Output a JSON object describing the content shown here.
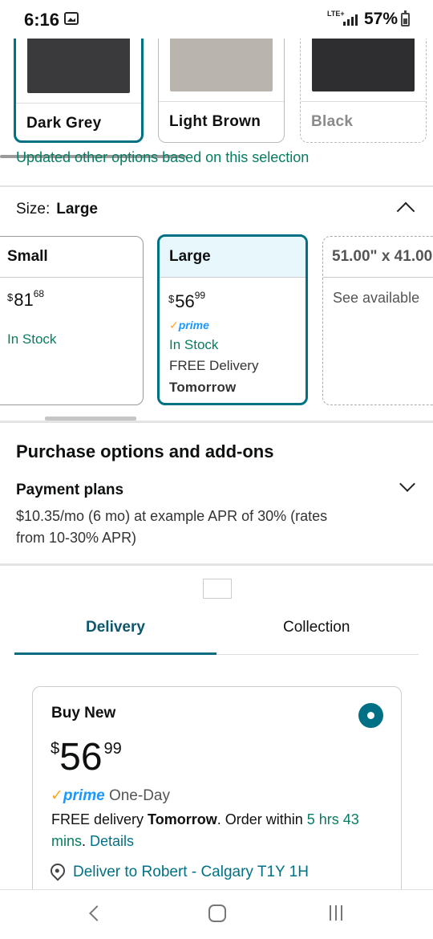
{
  "status_bar": {
    "time": "6:16",
    "network": "LTE+",
    "battery": "57%"
  },
  "colors": {
    "accent": "#007185",
    "success_green": "#067d62",
    "prime_blue": "#1a98ff",
    "prime_check": "#ffa41c",
    "swatches": [
      {
        "label": "Dark Grey",
        "state": "selected",
        "image_color": "#3a3a3c"
      },
      {
        "label": "Light Brown",
        "state": "available",
        "image_color": "#b9b5ae"
      },
      {
        "label": "Black",
        "state": "unavailable",
        "image_color": "#2e2e30"
      }
    ],
    "updated_message": "Updated other options based on this selection"
  },
  "size": {
    "label": "Size:",
    "selected": "Large",
    "options": [
      {
        "name": "Small",
        "currency": "$",
        "price_whole": "81",
        "price_fraction": "68",
        "stock": "In Stock"
      },
      {
        "name": "Large",
        "currency": "$",
        "price_whole": "56",
        "price_fraction": "99",
        "prime": "prime",
        "stock": "In Stock",
        "delivery_line1": "FREE Delivery",
        "delivery_line2": "Tomorrow"
      },
      {
        "name": "51.00\" x 41.00",
        "see_available": "See available"
      }
    ]
  },
  "purchase": {
    "title": "Purchase options and add-ons",
    "payment_plans_title": "Payment plans",
    "payment_plans_text": "$10.35/mo (6 mo) at example APR of 30% (rates from 10-30% APR)"
  },
  "tabs": {
    "delivery": "Delivery",
    "collection": "Collection"
  },
  "buy_new": {
    "title": "Buy New",
    "currency": "$",
    "price_whole": "56",
    "price_fraction": "99",
    "prime_word": "prime",
    "prime_suffix": "One-Day",
    "free_delivery": "FREE delivery",
    "delivery_day": "Tomorrow",
    "order_within": ". Order within",
    "time_left": "5 hrs 43 mins",
    "details": "Details",
    "deliver_to": "Deliver to Robert - Calgary T1Y 1H"
  }
}
